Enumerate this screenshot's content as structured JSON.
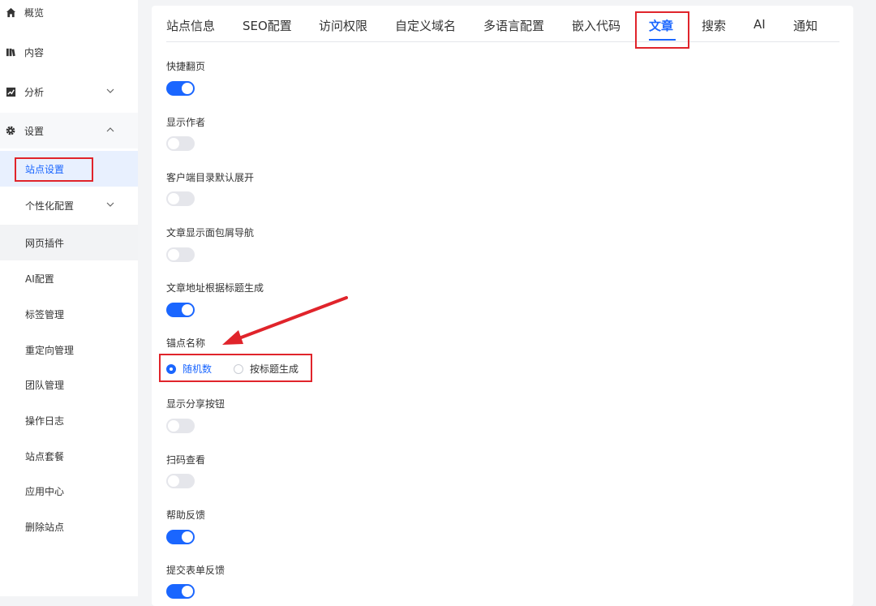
{
  "sidebar": {
    "items": [
      {
        "label": "概览",
        "icon": "home-icon"
      },
      {
        "label": "内容",
        "icon": "book-icon"
      },
      {
        "label": "分析",
        "icon": "chart-icon"
      },
      {
        "label": "设置",
        "icon": "gear-icon"
      },
      {
        "label": "站点设置"
      },
      {
        "label": "个性化配置"
      },
      {
        "label": "网页插件"
      },
      {
        "label": "AI配置"
      },
      {
        "label": "标签管理"
      },
      {
        "label": "重定向管理"
      },
      {
        "label": "团队管理"
      },
      {
        "label": "操作日志"
      },
      {
        "label": "站点套餐"
      },
      {
        "label": "应用中心"
      },
      {
        "label": "删除站点"
      }
    ]
  },
  "tabs": [
    {
      "label": "站点信息"
    },
    {
      "label": "SEO配置"
    },
    {
      "label": "访问权限"
    },
    {
      "label": "自定义域名"
    },
    {
      "label": "多语言配置"
    },
    {
      "label": "嵌入代码"
    },
    {
      "label": "文章"
    },
    {
      "label": "搜索"
    },
    {
      "label": "AI"
    },
    {
      "label": "通知"
    }
  ],
  "settings": [
    {
      "label": "快捷翻页",
      "on": true
    },
    {
      "label": "显示作者",
      "on": false
    },
    {
      "label": "客户端目录默认展开",
      "on": false
    },
    {
      "label": "文章显示面包屑导航",
      "on": false
    },
    {
      "label": "文章地址根据标题生成",
      "on": true
    },
    {
      "label": "显示分享按钮",
      "on": false
    },
    {
      "label": "扫码查看",
      "on": false
    },
    {
      "label": "帮助反馈",
      "on": true
    },
    {
      "label": "提交表单反馈",
      "on": true
    }
  ],
  "anchor": {
    "label": "锚点名称",
    "options": [
      {
        "label": "随机数",
        "checked": true
      },
      {
        "label": "按标题生成",
        "checked": false
      }
    ]
  },
  "colors": {
    "accent": "#1a66ff",
    "highlight_box": "#e0242b",
    "arrow": "#e0242b"
  }
}
